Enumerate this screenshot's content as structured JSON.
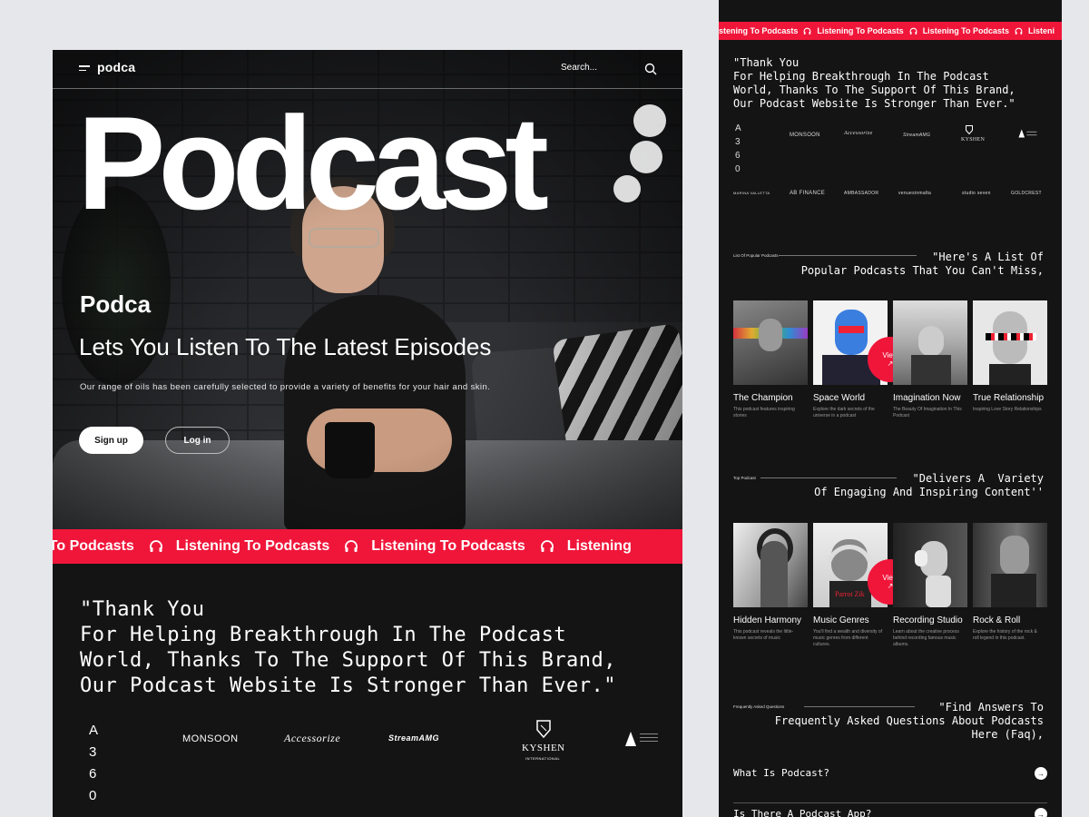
{
  "nav": {
    "logo": "podca",
    "search_placeholder": "Search..."
  },
  "hero": {
    "big_title": "Podcast",
    "brand": "Podca",
    "headline": "Lets You Listen To The Latest Episodes",
    "description": "Our range of oils has been carefully selected to provide a variety of benefits for your hair and skin.",
    "signup_label": "Sign up",
    "login_label": "Log in"
  },
  "ticker": {
    "items": [
      "istening To Podcasts",
      "Listening To Podcasts",
      "Listening To Podcasts",
      "Listening"
    ]
  },
  "right_ticker": {
    "items": [
      "Listening To Podcasts",
      "Listening To Podcasts",
      "Listening To Podcasts",
      "Listeni"
    ]
  },
  "testimonial": {
    "quote": "\"Thank You\nFor Helping Breakthrough In The Podcast\nWorld, Thanks To The Support Of This Brand,\nOur Podcast Website Is Stronger Than Ever.\""
  },
  "brands": {
    "a360": "A 3 6 0",
    "items": [
      "MONSOON",
      "Accessorize",
      "StreamAMG",
      "KYSHEN",
      "INTERNATIONAL"
    ],
    "row2": [
      "MARINA VALLETTA",
      "AB FINANCE",
      "AMBASSADOR",
      "venuesinmalta",
      "studio seven",
      "GOLDCREST"
    ]
  },
  "popular": {
    "label": "List Of Popular Podcasts",
    "title": "\"Here's A List Of\nPopular Podcasts That You Can't Miss,",
    "items": [
      {
        "title": "The Champion",
        "sub": "This podcast features inspiring stories"
      },
      {
        "title": "Space World",
        "sub": "Explore the dark secrets of the universe in a podcast"
      },
      {
        "title": "Imagination Now",
        "sub": "The Beauty Of Imagination In This Podcast"
      },
      {
        "title": "True Relationship",
        "sub": "Inspiring Love Story Relationships"
      }
    ],
    "view_label": "View"
  },
  "top": {
    "label": "Top Podcast",
    "title": "\"Delivers A  Variety\nOf Engaging And Inspiring Content''",
    "items": [
      {
        "title": "Hidden Harmony",
        "sub": "This podcast reveals the little-known secrets of music"
      },
      {
        "title": "Music Genres",
        "sub": "You'll find a wealth and diversity of music genres from different cultures."
      },
      {
        "title": "Recording Studio",
        "sub": "Learn about the creative process behind recording famous music albums."
      },
      {
        "title": "Rock & Roll",
        "sub": "Explore the history of the rock & roll legend in this podcast."
      }
    ],
    "view_label": "View",
    "cover_text": "Parrot Zik"
  },
  "faq": {
    "label": "Frequently Asked Questions",
    "title": "\"Find Answers To\nFrequently Asked Questions About Podcasts\nHere (Faq),",
    "items": [
      "What Is Podcast?",
      "Is There A Podcast App?"
    ]
  },
  "colors": {
    "accent": "#f0163a",
    "bg": "#141414"
  }
}
